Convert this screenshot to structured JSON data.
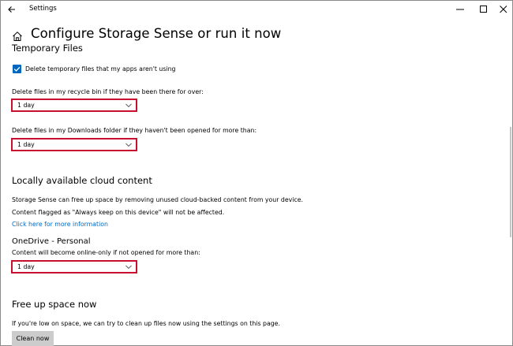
{
  "window": {
    "title": "Settings"
  },
  "page": {
    "title": "Configure Storage Sense or run it now"
  },
  "temp_files": {
    "heading": "Temporary Files",
    "checkbox_label": "Delete temporary files that my apps aren't using",
    "checkbox_checked": true,
    "recycle_label": "Delete files in my recycle bin if they have been there for over:",
    "recycle_value": "1 day",
    "downloads_label": "Delete files in my Downloads folder if they haven't been opened for more than:",
    "downloads_value": "1 day"
  },
  "cloud": {
    "heading": "Locally available cloud content",
    "desc1": "Storage Sense can free up space by removing unused cloud-backed content from your device.",
    "desc2": "Content flagged as \"Always keep on this device\" will not be affected.",
    "link": "Click here for more information",
    "onedrive_heading": "OneDrive - Personal",
    "onedrive_label": "Content will become online-only if not opened for more than:",
    "onedrive_value": "1 day"
  },
  "free_space": {
    "heading": "Free up space now",
    "desc": "If you're low on space, we can try to clean up files now using the settings on this page.",
    "button_label": "Clean now"
  },
  "icons": {
    "back": "back-arrow-icon",
    "home": "home-icon",
    "minimize": "minimize-icon",
    "maximize": "maximize-icon",
    "close": "close-icon",
    "dropdown": "chevron-down-icon",
    "check": "checkmark-icon"
  },
  "colors": {
    "accent": "#0067c0",
    "highlight_border": "#c8102e",
    "button_bg": "#cccccc"
  }
}
